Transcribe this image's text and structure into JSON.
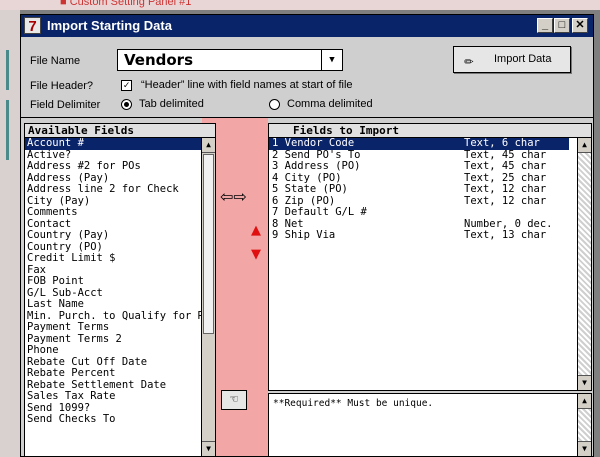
{
  "background": {
    "partial_text": "■ Custom Setting Panel #1"
  },
  "window": {
    "title": "Import Starting Data",
    "app_icon_glyph": "7"
  },
  "form": {
    "file_name_label": "File Name",
    "file_name_value": "Vendors",
    "import_button_label": "Import Data",
    "file_header_label": "File Header?",
    "file_header_checked": true,
    "file_header_text": "“Header” line with field names at start of file",
    "delimiter_label": "Field Delimiter",
    "tab_label": "Tab delimited",
    "comma_label": "Comma delimited",
    "selected_delimiter": "tab"
  },
  "available": {
    "header": "Available Fields",
    "items": [
      "Account #",
      "Active?",
      "Address #2 for POs",
      "Address (Pay)",
      "Address line 2 for Check",
      "City (Pay)",
      "Comments",
      "Contact",
      "Country (Pay)",
      "Country (PO)",
      "Credit Limit $",
      "Fax",
      "FOB Point",
      "G/L Sub-Acct",
      "Last Name",
      "Min. Purch. to Qualify for Rebate",
      "Payment Terms",
      "Payment Terms 2",
      "Phone",
      "Rebate Cut Off Date",
      "Rebate Percent",
      "Rebate Settlement Date",
      "Sales Tax Rate",
      "Send 1099?",
      "Send Checks To"
    ],
    "selected_index": 0
  },
  "imports": {
    "header": "Fields to Import",
    "rows": [
      {
        "name": "1 Vendor Code",
        "type": "Text, 6 char"
      },
      {
        "name": "2 Send PO's To",
        "type": "Text, 45 char"
      },
      {
        "name": "3 Address (PO)",
        "type": "Text, 45 char"
      },
      {
        "name": "4 City (PO)",
        "type": "Text, 25 char"
      },
      {
        "name": "5 State (PO)",
        "type": "Text, 12 char"
      },
      {
        "name": "6 Zip (PO)",
        "type": "Text, 12 char"
      },
      {
        "name": "7 Default G/L #",
        "type": ""
      },
      {
        "name": "8 Net",
        "type": "Number, 0 dec."
      },
      {
        "name": "9 Ship Via",
        "type": "Text, 13 char"
      }
    ],
    "selected_index": 0
  },
  "note": "**Required** Must be unique.",
  "colors": {
    "titlebar": "#0a246a",
    "selection": "#0a246a",
    "pink": "#f3a6a6",
    "arrow_red": "#e01010"
  }
}
